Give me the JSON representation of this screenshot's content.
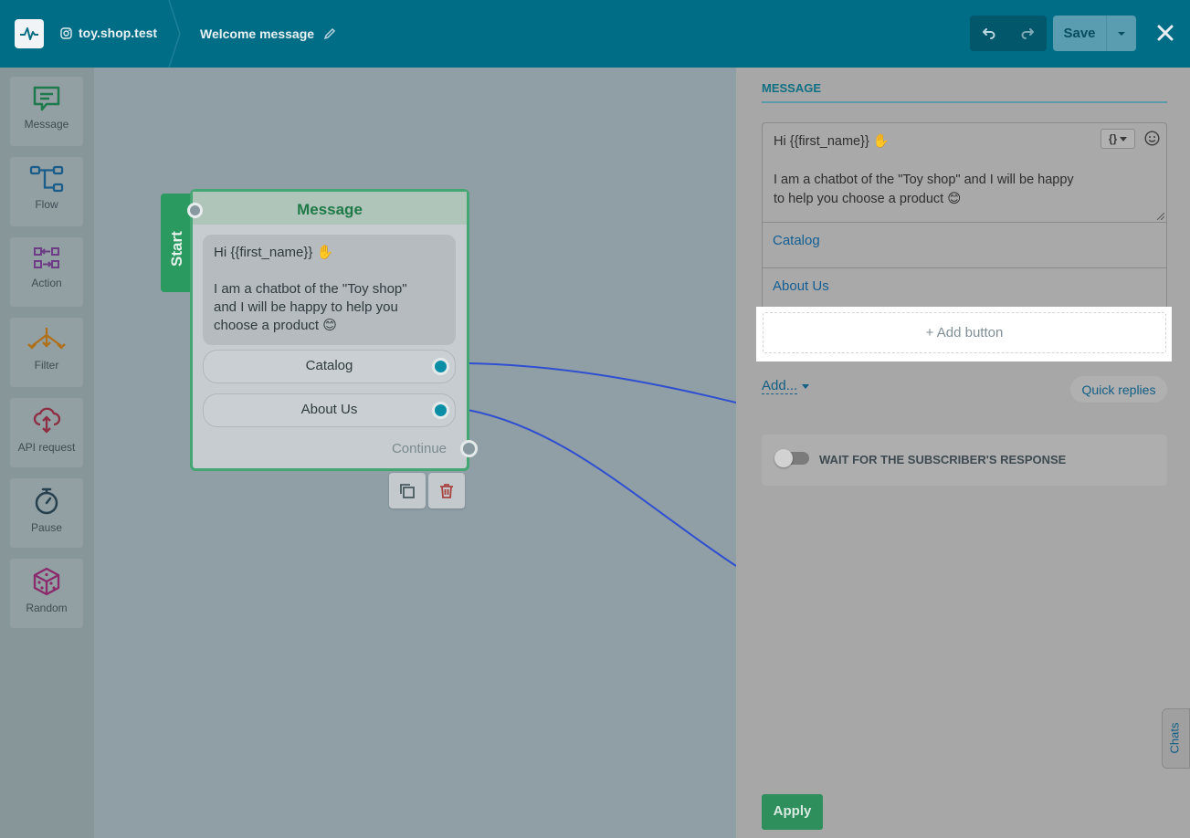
{
  "header": {
    "account": "toy.shop.test",
    "flow_title": "Welcome message",
    "save_label": "Save"
  },
  "toolbox": [
    {
      "label": "Message",
      "icon": "message-icon"
    },
    {
      "label": "Flow",
      "icon": "flow-icon"
    },
    {
      "label": "Action",
      "icon": "action-icon"
    },
    {
      "label": "Filter",
      "icon": "filter-icon"
    },
    {
      "label": "API request",
      "icon": "api-request-icon"
    },
    {
      "label": "Pause",
      "icon": "pause-icon"
    },
    {
      "label": "Random",
      "icon": "random-icon"
    }
  ],
  "canvas": {
    "start_label": "Start",
    "node": {
      "title": "Message",
      "text": "Hi {{first_name}} ✋\n\nI am a chatbot of the \"Toy shop\"\nand I will be happy to help you\nchoose a product 😊",
      "buttons": [
        "Catalog",
        "About Us"
      ],
      "continue_label": "Continue"
    }
  },
  "panel": {
    "tab": "MESSAGE",
    "editor_text": "Hi {{first_name}} ✋\n\nI am a chatbot of the \"Toy shop\" and I will be happy\nto help you choose a product 😊",
    "buttons": [
      "Catalog",
      "About Us"
    ],
    "add_button": "+ Add button",
    "add_link": "Add...",
    "quick_replies": "Quick replies",
    "wait_label": "WAIT FOR THE SUBSCRIBER'S RESPONSE",
    "wait_enabled": false,
    "apply_label": "Apply",
    "chats_label": "Chats"
  },
  "colors": {
    "header": "#006d86",
    "node_border": "#43a673",
    "port": "#0a8ea5",
    "wire": "#2f4fd0",
    "apply": "#2e8e5c"
  }
}
